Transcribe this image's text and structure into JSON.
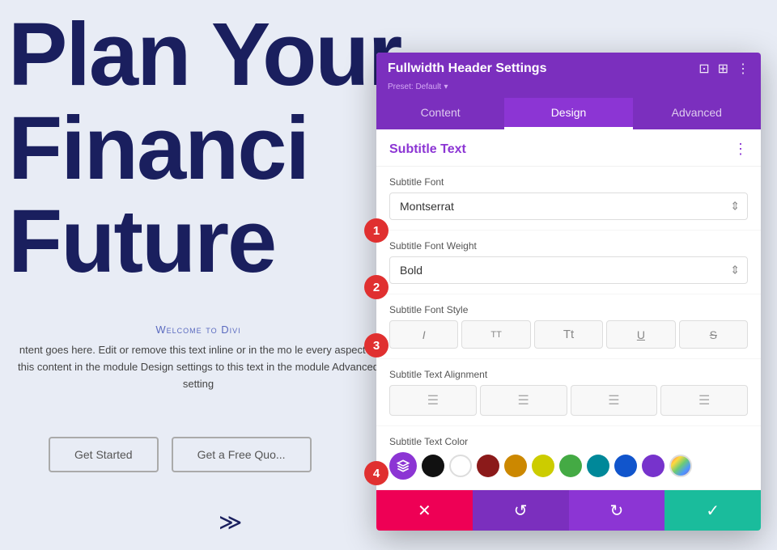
{
  "page": {
    "hero": {
      "line1": "Plan Your",
      "line2": "Financi",
      "line3": "Future"
    },
    "welcome_label": "Welcome to Divi",
    "body_text": "ntent goes here. Edit or remove this text inline or in the mo\nle every aspect of this content in the module Design settings\nto this text in the module Advanced setting",
    "buttons": {
      "get_started": "Get Started",
      "free_quote": "Get a Free Quo..."
    }
  },
  "panel": {
    "title": "Fullwidth Header Settings",
    "preset": "Preset: Default",
    "tabs": [
      {
        "id": "content",
        "label": "Content"
      },
      {
        "id": "design",
        "label": "Design",
        "active": true
      },
      {
        "id": "advanced",
        "label": "Advanced"
      }
    ],
    "section_title": "Subtitle Text",
    "fields": {
      "subtitle_font": {
        "label": "Subtitle Font",
        "value": "Montserrat"
      },
      "subtitle_font_weight": {
        "label": "Subtitle Font Weight",
        "value": "Bold"
      },
      "subtitle_font_style": {
        "label": "Subtitle Font Style",
        "buttons": [
          "I",
          "TT",
          "Tt",
          "U",
          "S"
        ]
      },
      "subtitle_text_alignment": {
        "label": "Subtitle Text Alignment",
        "buttons": [
          "left",
          "center",
          "right",
          "justify"
        ]
      },
      "subtitle_text_color": {
        "label": "Subtitle Text Color",
        "colors": [
          {
            "id": "picker",
            "type": "picker",
            "color": "#8c35d4"
          },
          {
            "id": "black",
            "color": "#111111"
          },
          {
            "id": "white",
            "color": "#ffffff"
          },
          {
            "id": "red",
            "color": "#8B1A1A"
          },
          {
            "id": "orange",
            "color": "#CC8800"
          },
          {
            "id": "yellow",
            "color": "#CCCC00"
          },
          {
            "id": "green",
            "color": "#44AA44"
          },
          {
            "id": "teal",
            "color": "#008899"
          },
          {
            "id": "blue",
            "color": "#1155CC"
          },
          {
            "id": "purple",
            "color": "#7733CC"
          },
          {
            "id": "gradient",
            "type": "gradient"
          }
        ]
      }
    },
    "footer": {
      "cancel": "✕",
      "undo": "↺",
      "redo": "↻",
      "save": "✓"
    }
  },
  "badges": [
    {
      "id": "1",
      "label": "1"
    },
    {
      "id": "2",
      "label": "2"
    },
    {
      "id": "3",
      "label": "3"
    },
    {
      "id": "4",
      "label": "4"
    }
  ]
}
